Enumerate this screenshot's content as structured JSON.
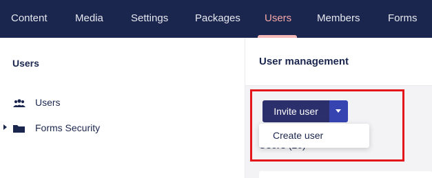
{
  "nav": {
    "tabs": [
      {
        "label": "Content"
      },
      {
        "label": "Media"
      },
      {
        "label": "Settings"
      },
      {
        "label": "Packages"
      },
      {
        "label": "Users",
        "active": true
      },
      {
        "label": "Members"
      },
      {
        "label": "Forms"
      }
    ]
  },
  "tree": {
    "title": "Users",
    "items": [
      {
        "label": "Users",
        "icon": "users-icon"
      },
      {
        "label": "Forms Security",
        "icon": "folder-icon",
        "expandable": true
      }
    ]
  },
  "main": {
    "title": "User management",
    "invite_button": "Invite user",
    "dropdown": {
      "items": [
        {
          "label": "Create user"
        }
      ]
    },
    "users_heading": "Users",
    "users_count": "(26)"
  },
  "colors": {
    "nav_bg": "#1b264f",
    "active_tab": "#f5a8a8",
    "primary_button": "#2b2f6b",
    "caret_button": "#3544b1",
    "highlight": "#e3161b"
  }
}
